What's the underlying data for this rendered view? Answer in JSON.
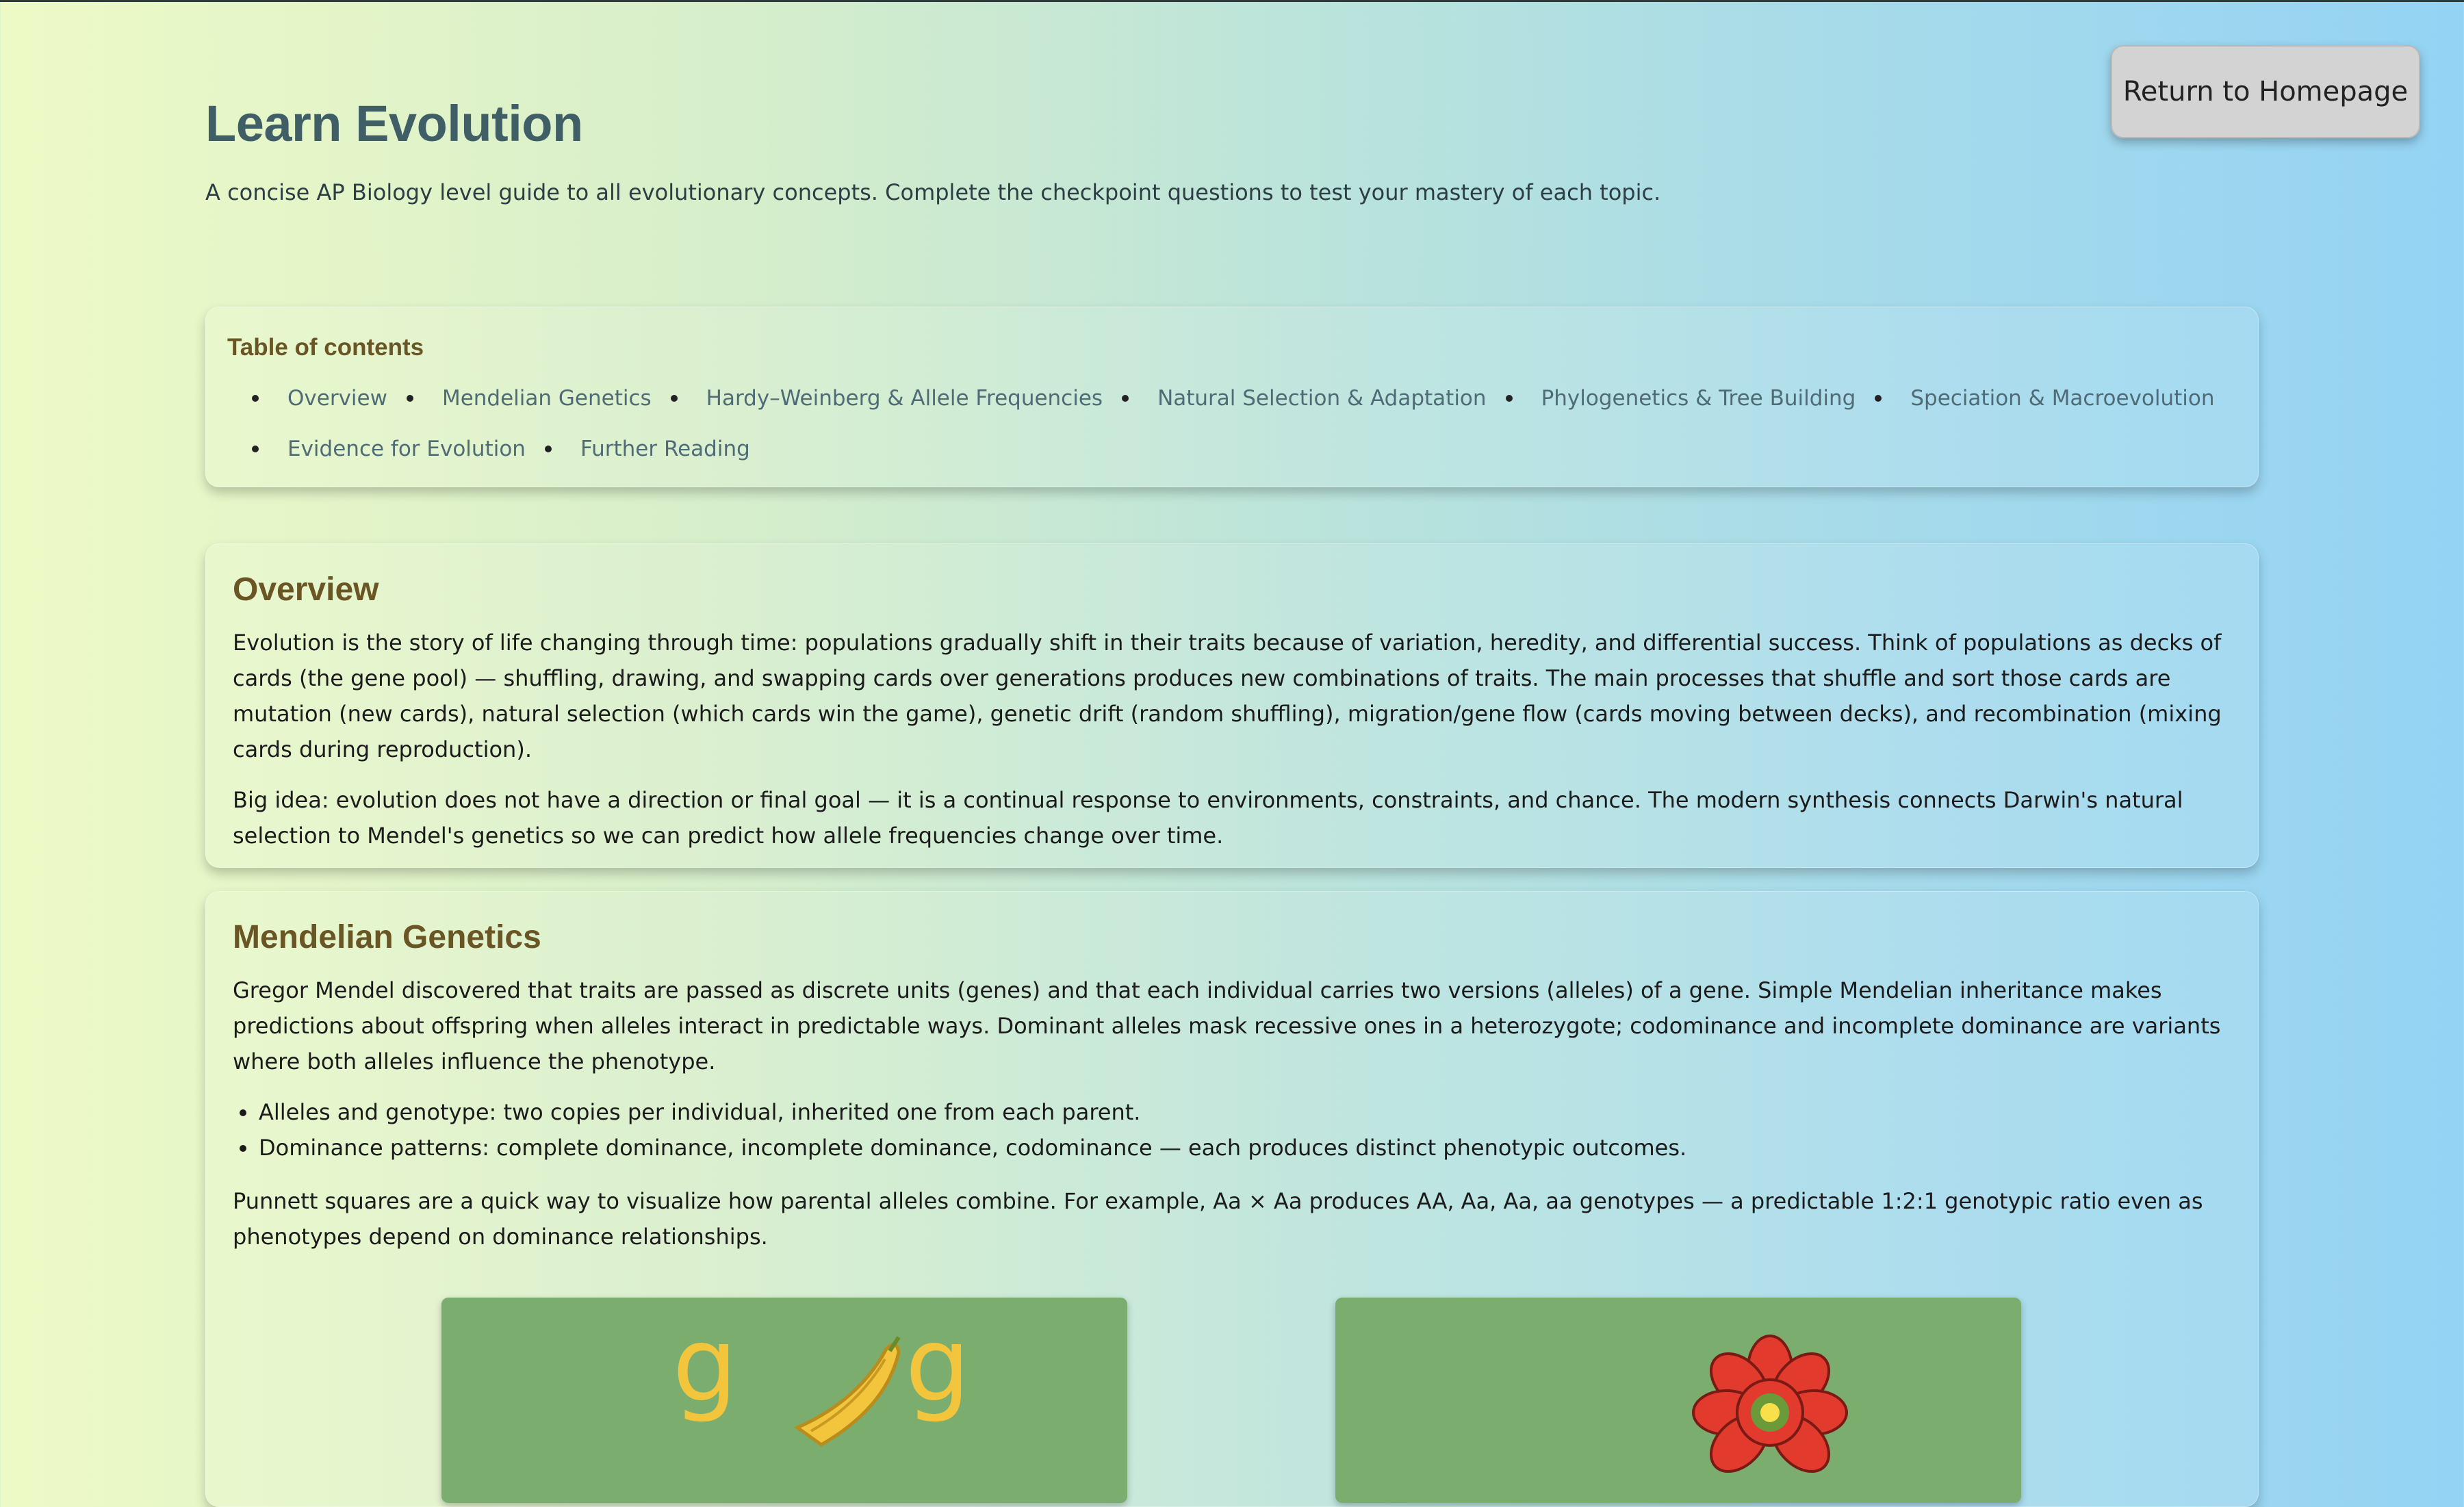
{
  "header": {
    "title": "Learn Evolution",
    "subtitle": "A concise AP Biology level guide to all evolutionary concepts. Complete the checkpoint questions to test your mastery of each topic.",
    "home_button": "Return to Homepage"
  },
  "toc": {
    "title": "Table of contents",
    "items": [
      "Overview",
      "Mendelian Genetics",
      "Hardy–Weinberg & Allele Frequencies",
      "Natural Selection & Adaptation",
      "Phylogenetics & Tree Building",
      "Speciation & Macroevolution",
      "Evidence for Evolution",
      "Further Reading"
    ]
  },
  "overview": {
    "title": "Overview",
    "p1": "Evolution is the story of life changing through time: populations gradually shift in their traits because of variation, heredity, and differential success. Think of populations as decks of cards (the gene pool) — shuffling, drawing, and swapping cards over generations produces new combinations of traits. The main processes that shuffle and sort those cards are mutation (new cards), natural selection (which cards win the game), genetic drift (random shuffling), migration/gene flow (cards moving between decks), and recombination (mixing cards during reproduction).",
    "p2": "Big idea: evolution does not have a direction or final goal — it is a continual response to environments, constraints, and chance. The modern synthesis connects Darwin's natural selection to Mendel's genetics so we can predict how allele frequencies change over time."
  },
  "mendel": {
    "title": "Mendelian Genetics",
    "p1": "Gregor Mendel discovered that traits are passed as discrete units (genes) and that each individual carries two versions (alleles) of a gene. Simple Mendelian inheritance makes predictions about offspring when alleles interact in predictable ways. Dominant alleles mask recessive ones in a heterozygote; codominance and incomplete dominance are variants where both alleles influence the phenotype.",
    "bullets": [
      "Alleles and genotype: two copies per individual, inherited one from each parent.",
      "Dominance patterns: complete dominance, incomplete dominance, codominance — each produces distinct phenotypic outcomes."
    ],
    "p2": "Punnett squares are a quick way to visualize how parental alleles combine. For example, Aa × Aa produces AA, Aa, Aa, aa genotypes — a predictable 1:2:1 genotypic ratio even as phenotypes depend on dominance relationships.",
    "img_left_letters": "g g",
    "img_left": "pea-pod-illustration",
    "img_right": "red-flower-illustration"
  },
  "colors": {
    "heading_brown": "#6a5624",
    "title_slate": "#3f5e66",
    "image_green": "#7bae6e",
    "pod_yellow": "#f2c53d",
    "flower_red": "#e23b2e"
  }
}
